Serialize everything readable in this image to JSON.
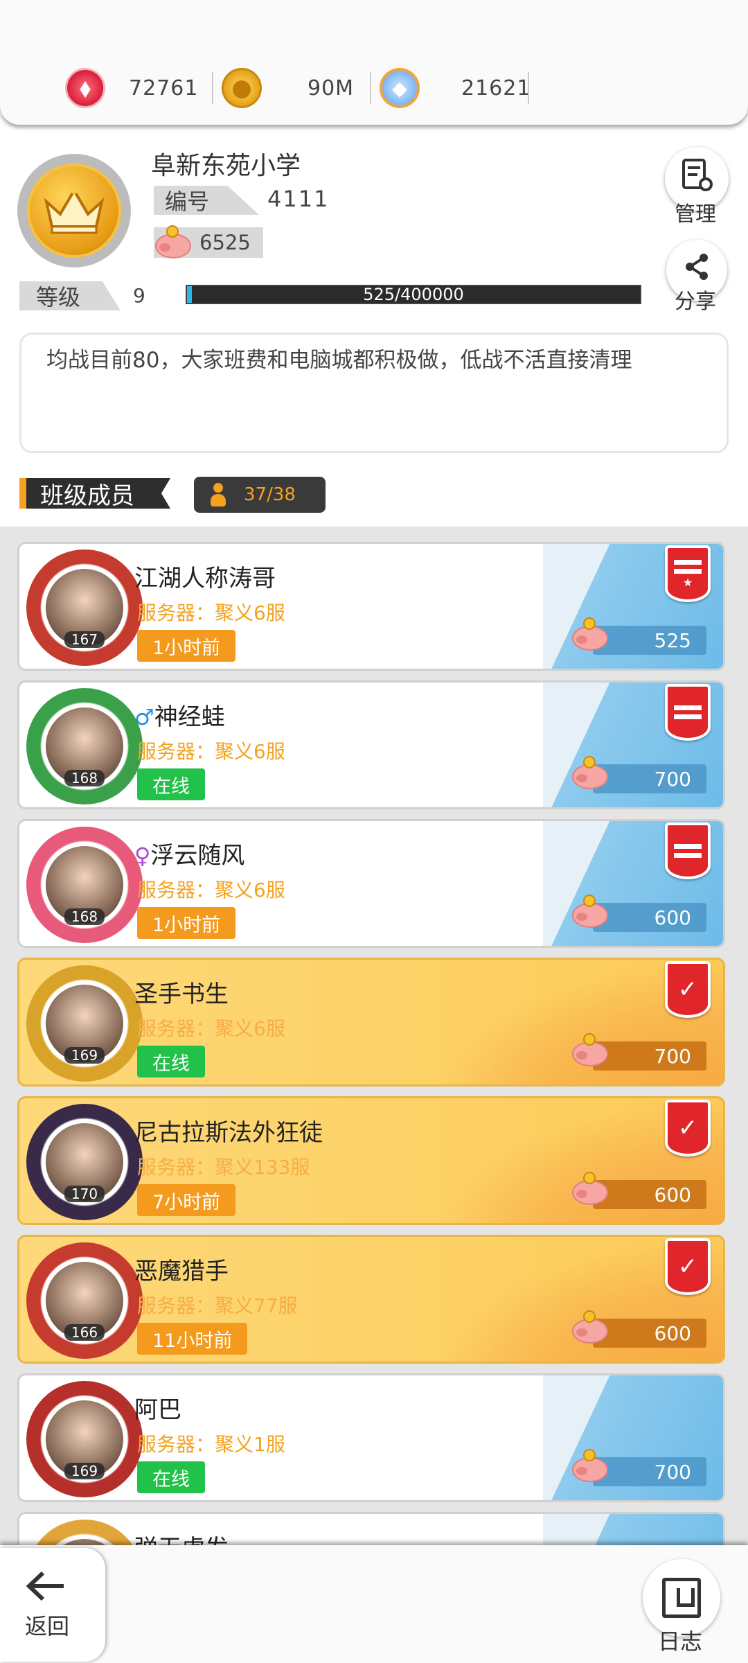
{
  "currencies": [
    {
      "icon": "red-gem-icon",
      "value": "72761"
    },
    {
      "icon": "gold-coin-icon",
      "value": "90M"
    },
    {
      "icon": "diamond-ring-icon",
      "value": "21621"
    }
  ],
  "class_info": {
    "name": "阜新东苑小学",
    "id_label": "编号",
    "id_value": "4111",
    "funds": "6525",
    "level_label": "等级",
    "level_value": "9",
    "exp_text": "525/400000",
    "exp_progress": 0.0013,
    "notice": "均战目前80，大家班费和电脑城都积极做，低战不活直接清理"
  },
  "actions": {
    "manage_label": "管理",
    "share_label": "分享"
  },
  "members_section": {
    "title": "班级成员",
    "count": "37/38"
  },
  "members": [
    {
      "name": "江湖人称涛哥",
      "gender": "",
      "server": "服务器：聚义6服",
      "status": "1小时前",
      "online": false,
      "level": "167",
      "contrib": "525",
      "rank": "leader",
      "style": "white",
      "avatar_color": "#c53b2e"
    },
    {
      "name": "神经蛙",
      "gender": "♂",
      "server": "服务器：聚义6服",
      "status": "在线",
      "online": true,
      "level": "168",
      "contrib": "700",
      "rank": "vice",
      "style": "white",
      "avatar_color": "#3aa14a"
    },
    {
      "name": "浮云随风",
      "gender": "♀",
      "server": "服务器：聚义6服",
      "status": "1小时前",
      "online": false,
      "level": "168",
      "contrib": "600",
      "rank": "vice",
      "style": "white",
      "avatar_color": "#e85a7a"
    },
    {
      "name": "圣手书生",
      "gender": "",
      "server": "服务器：聚义6服",
      "status": "在线",
      "online": true,
      "level": "169",
      "contrib": "700",
      "rank": "elite",
      "style": "gold",
      "avatar_color": "#d9a32a"
    },
    {
      "name": "尼古拉斯法外狂徒",
      "gender": "",
      "server": "服务器：聚义133服",
      "status": "7小时前",
      "online": false,
      "level": "170",
      "contrib": "600",
      "rank": "elite",
      "style": "gold",
      "avatar_color": "#3a2a4a"
    },
    {
      "name": "恶魔猎手",
      "gender": "",
      "server": "服务器：聚义77服",
      "status": "11小时前",
      "online": false,
      "level": "166",
      "contrib": "600",
      "rank": "elite",
      "style": "gold",
      "avatar_color": "#c53b2e"
    },
    {
      "name": "阿巴",
      "gender": "",
      "server": "服务器：聚义1服",
      "status": "在线",
      "online": true,
      "level": "169",
      "contrib": "700",
      "rank": "none",
      "style": "white",
      "avatar_color": "#b5302a"
    },
    {
      "name": "弹无虚发",
      "gender": "",
      "server": "",
      "status": "",
      "online": false,
      "level": "",
      "contrib": "",
      "rank": "none",
      "style": "white",
      "avatar_color": "#e2a53a"
    }
  ],
  "bottom": {
    "back_label": "返回",
    "log_label": "日志"
  },
  "colors": {
    "accent_orange": "#f4a21d",
    "online_green": "#22c24a",
    "rank_red": "#e0262b",
    "exp_blue": "#29b9e8"
  }
}
